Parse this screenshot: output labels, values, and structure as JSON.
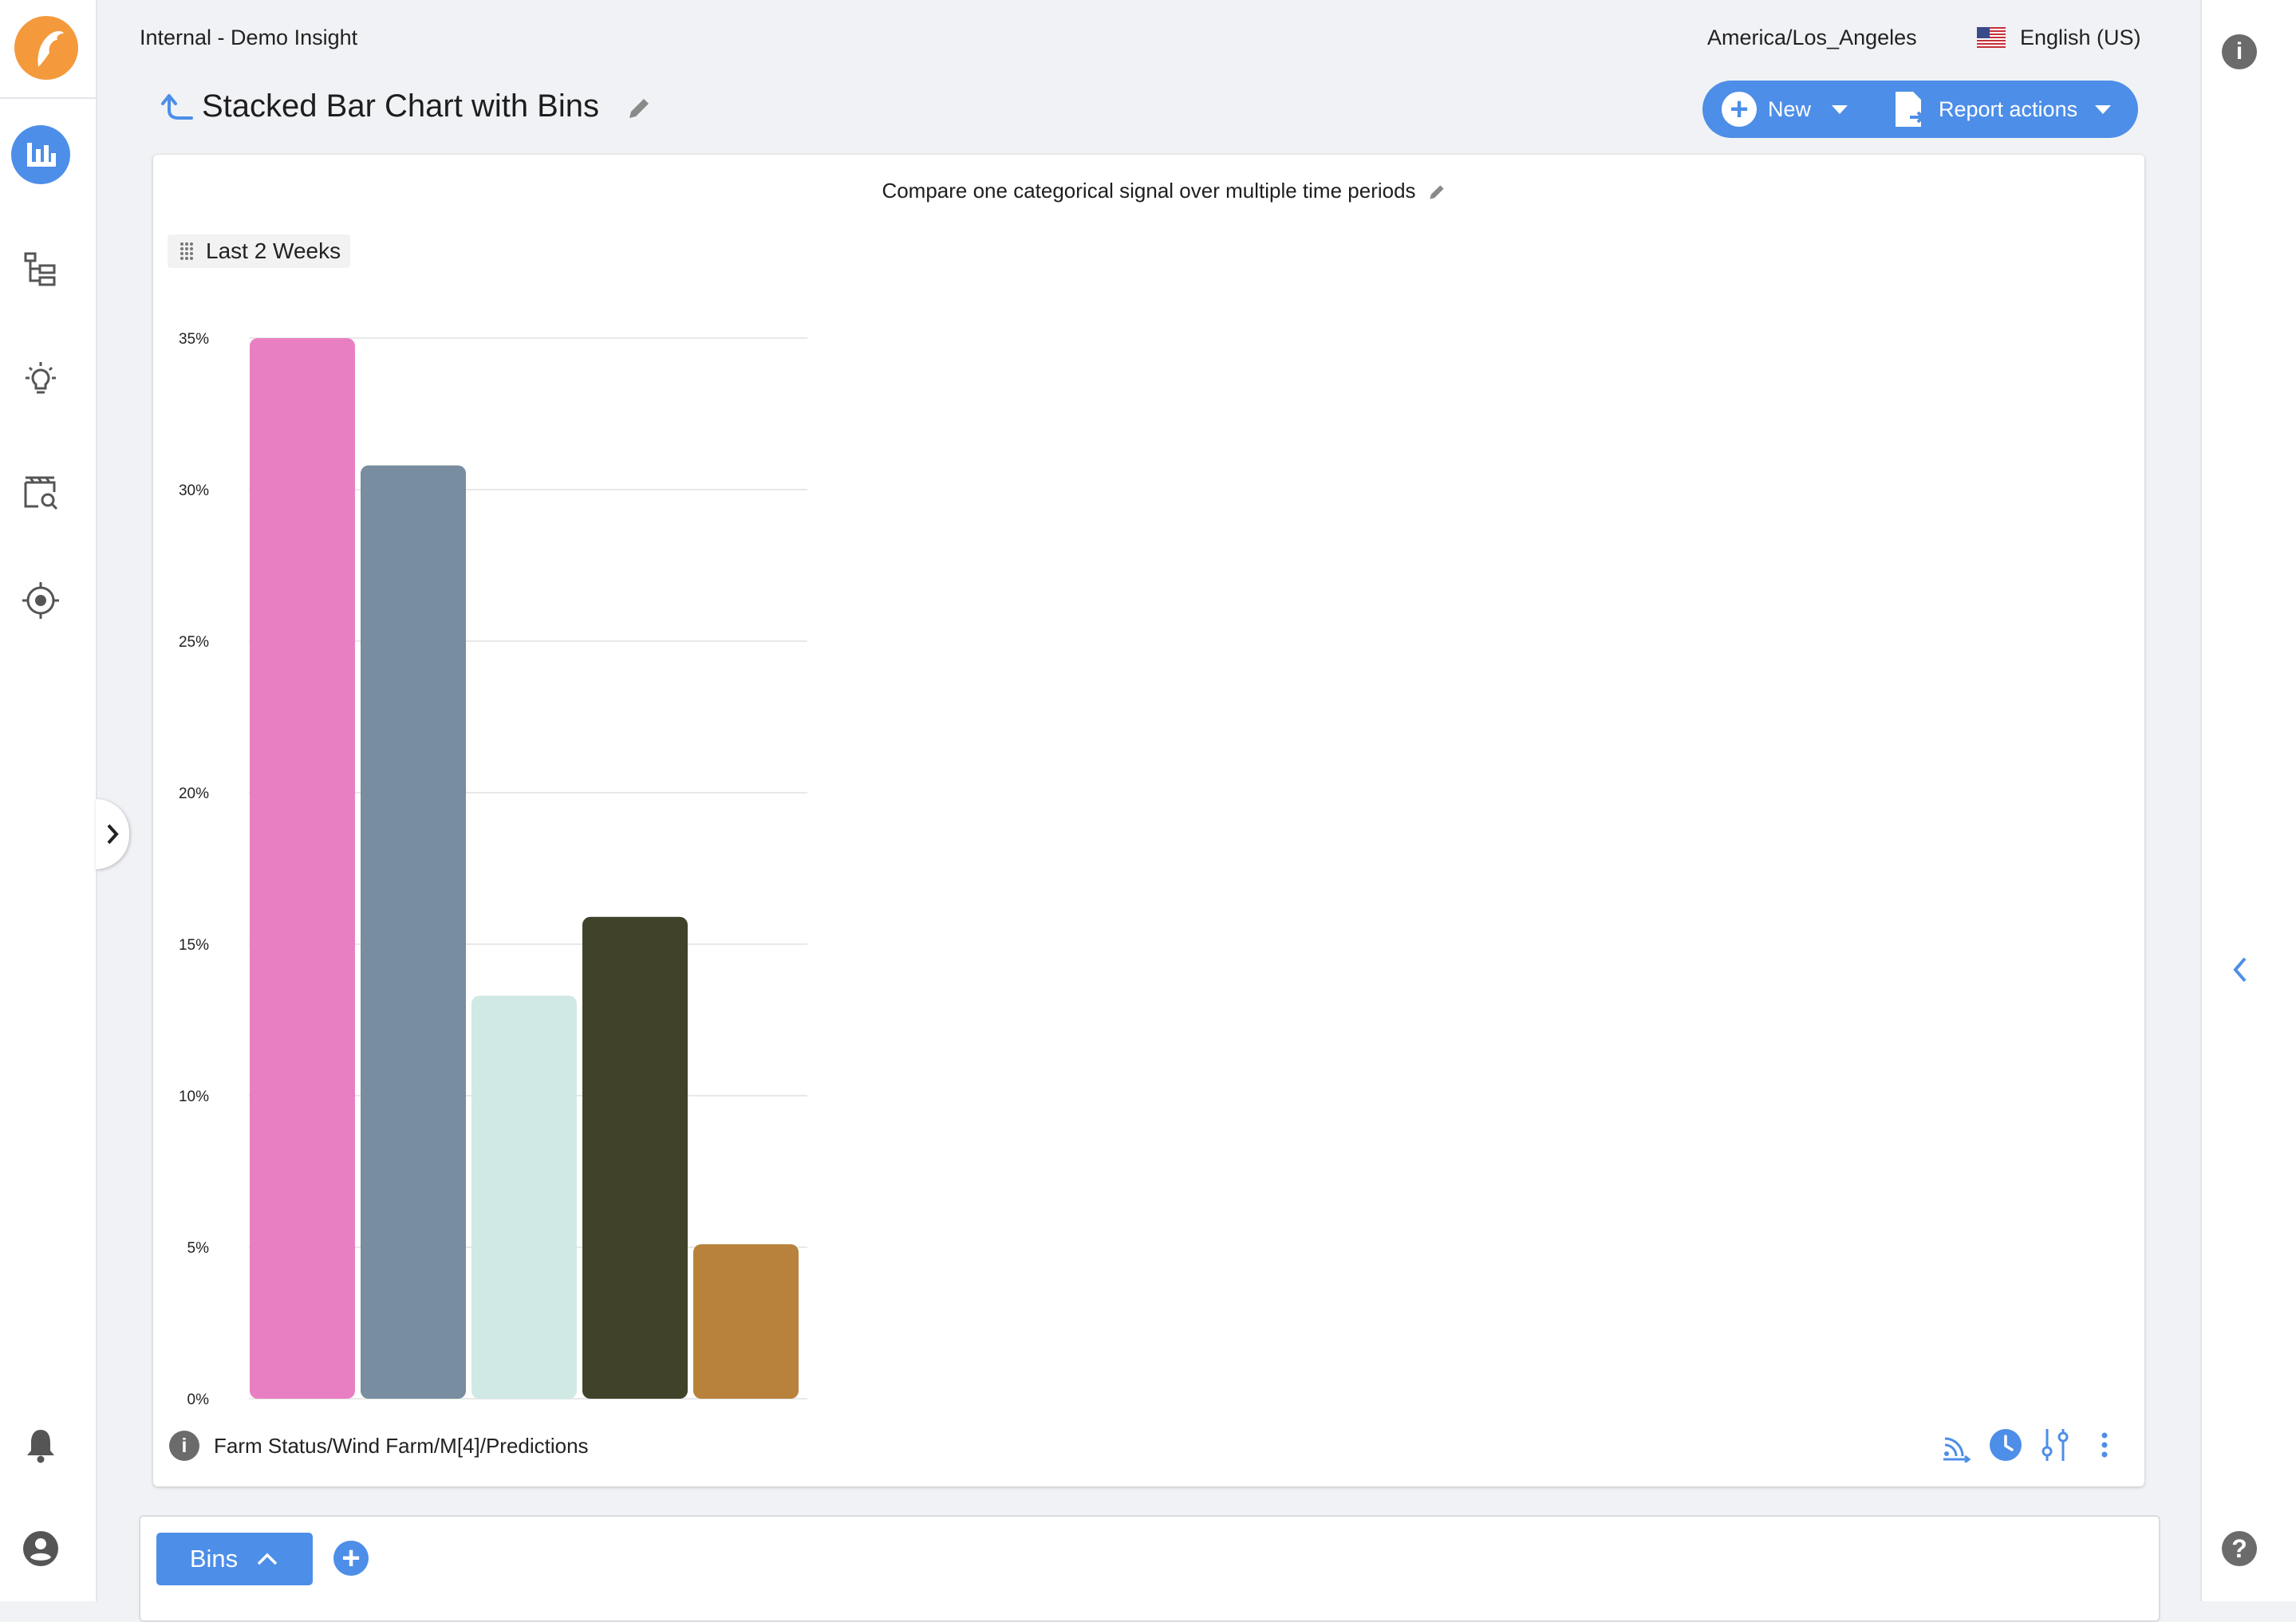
{
  "header": {
    "breadcrumb": "Internal - Demo Insight",
    "timezone": "America/Los_Angeles",
    "language": "English (US)",
    "report_title": "Stacked Bar Chart with Bins"
  },
  "actions": {
    "new_label": "New",
    "report_actions_label": "Report actions"
  },
  "nav": {
    "items": [
      "analytics-icon",
      "hierarchy-icon",
      "insights-icon",
      "event-search-icon",
      "target-icon",
      "bell-icon",
      "account-icon"
    ]
  },
  "chart": {
    "subtitle": "Compare one categorical signal over multiple time periods",
    "period_label": "Last 2 Weeks",
    "source_path": "Farm Status/Wind Farm/M[4]/Predictions"
  },
  "bottom": {
    "tab_label": "Bins"
  },
  "colors": {
    "accent": "#4d8ee8",
    "logo": "#f49a3c"
  },
  "chart_data": {
    "type": "bar",
    "categories": [
      "",
      "",
      "",
      "",
      ""
    ],
    "values": [
      35,
      30.8,
      13.3,
      15.9,
      5.1
    ],
    "colors": [
      "#e97fc3",
      "#788d9f",
      "#d0e9e5",
      "#40432a",
      "#b8823c"
    ],
    "title": "",
    "xlabel": "",
    "ylabel": "",
    "ylim": [
      0,
      35
    ],
    "yticks": [
      "0%",
      "5%",
      "10%",
      "15%",
      "20%",
      "25%",
      "30%",
      "35%"
    ],
    "grid": true
  }
}
